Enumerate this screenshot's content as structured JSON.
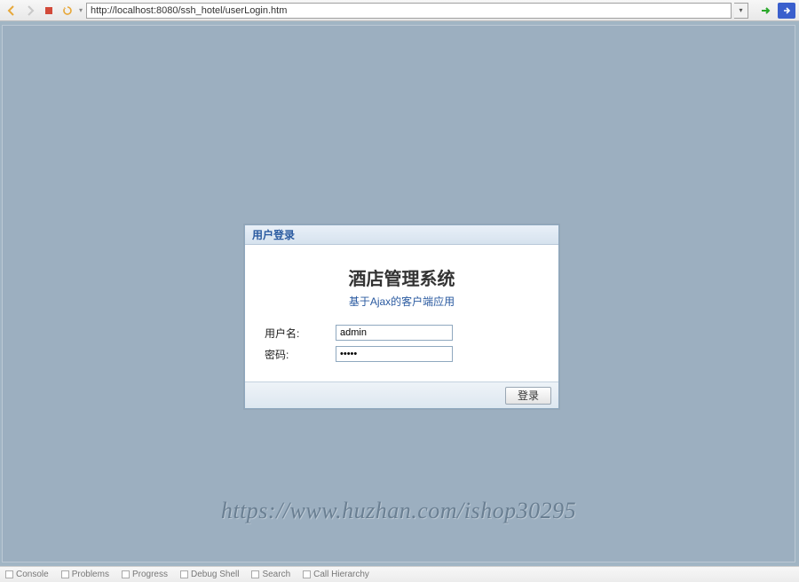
{
  "toolbar": {
    "url": "http://localhost:8080/ssh_hotel/userLogin.htm"
  },
  "login": {
    "panel_title": "用户登录",
    "system_title": "酒店管理系统",
    "system_subtitle": "基于Ajax的客户端应用",
    "username_label": "用户名:",
    "username_value": "admin",
    "password_label": "密码:",
    "password_value": "•••••",
    "login_button": "登录"
  },
  "watermark": "https://www.huzhan.com/ishop30295",
  "status": {
    "console": "Console",
    "problems": "Problems",
    "progress": "Progress",
    "debug_shell": "Debug Shell",
    "search": "Search",
    "call_hierarchy": "Call Hierarchy"
  }
}
